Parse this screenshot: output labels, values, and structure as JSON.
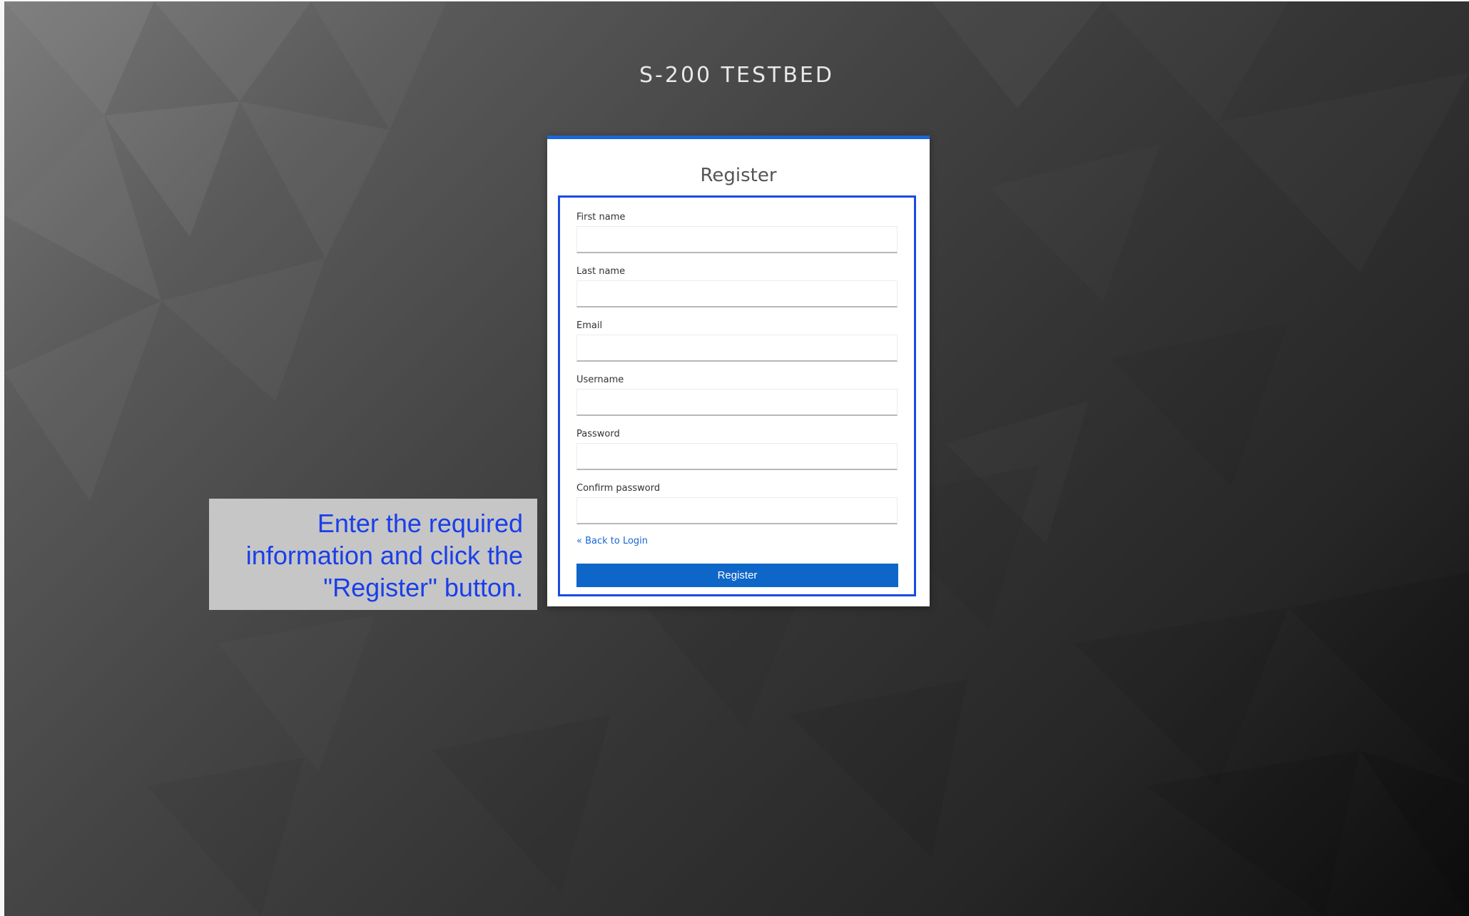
{
  "header": {
    "title": "S-200 TESTBED"
  },
  "form": {
    "title": "Register",
    "fields": [
      {
        "label": "First name",
        "value": "",
        "placeholder": ""
      },
      {
        "label": "Last name",
        "value": "",
        "placeholder": ""
      },
      {
        "label": "Email",
        "value": "",
        "placeholder": ""
      },
      {
        "label": "Username",
        "value": "",
        "placeholder": ""
      },
      {
        "label": "Password",
        "value": "",
        "placeholder": ""
      },
      {
        "label": "Confirm password",
        "value": "",
        "placeholder": ""
      }
    ],
    "back_link": "« Back to Login",
    "submit_label": "Register"
  },
  "callout": {
    "lines": [
      "Enter the required",
      "information and click the",
      "\"Register\" button."
    ]
  },
  "colors": {
    "accent": "#1a66d9",
    "button": "#0f66c9",
    "highlight": "#1a4be0",
    "callout_text": "#1a3fe8",
    "callout_bg": "#c6c6c6"
  }
}
